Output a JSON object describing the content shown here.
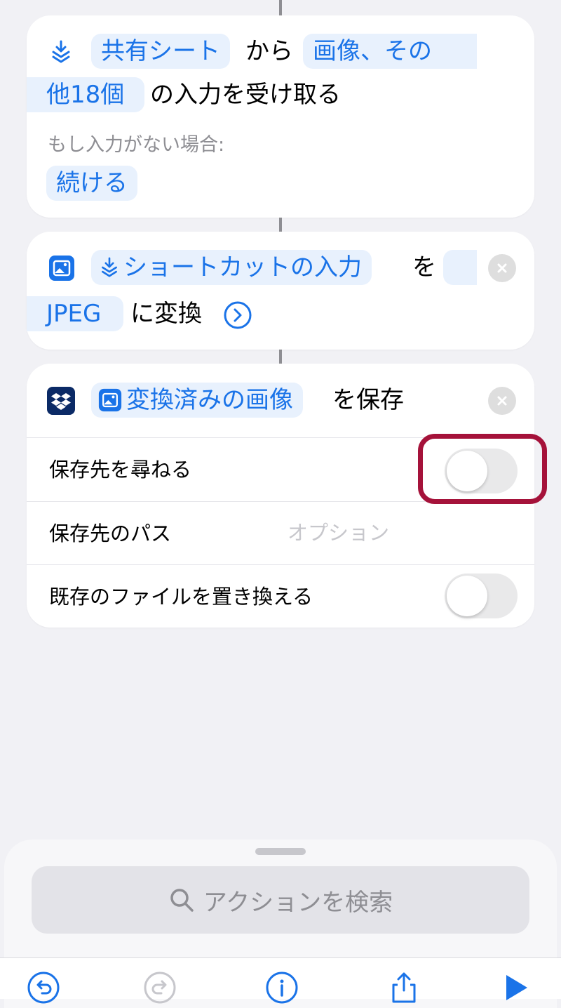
{
  "colors": {
    "accent": "#1a73e8",
    "token_bg": "#e8f1fd",
    "highlight": "#a5123a",
    "dropbox": "#0b2a66"
  },
  "action1": {
    "token_source": "共有シート",
    "text_from": "から",
    "token_types_line1": "画像、その",
    "token_types_line2": "他18個",
    "text_receive": "の入力を受け取る",
    "no_input_label": "もし入力がない場合:",
    "continue_token": "続ける",
    "icon": "shortcut-input-icon"
  },
  "action2": {
    "token_input": "ショートカットの入力",
    "text_wo": "を",
    "token_format": "JPEG",
    "text_convert": "に変換",
    "icon": "photo-icon"
  },
  "action3": {
    "token_images": "変換済みの画像",
    "text_save": "を保存",
    "icon": "dropbox-icon",
    "rows": [
      {
        "label": "保存先を尋ねる",
        "toggle_on": false
      },
      {
        "label": "保存先のパス",
        "placeholder": "オプション"
      },
      {
        "label": "既存のファイルを置き換える",
        "toggle_on": false
      }
    ]
  },
  "search": {
    "placeholder": "アクションを検索"
  },
  "toolbar": [
    "undo-icon",
    "redo-icon",
    "info-icon",
    "share-icon",
    "play-icon"
  ]
}
